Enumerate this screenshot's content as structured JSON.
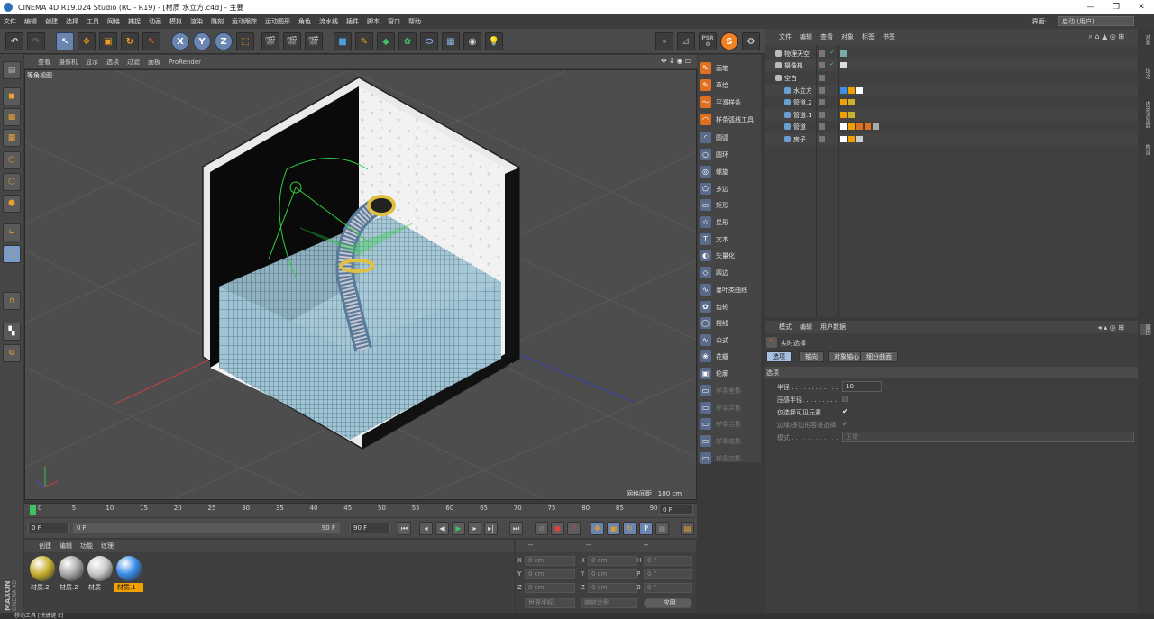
{
  "app": {
    "title": "CINEMA 4D R19.024 Studio (RC - R19) - [材质 水立方.c4d] - 主要"
  },
  "menu": [
    "文件",
    "编辑",
    "创建",
    "选择",
    "工具",
    "网格",
    "捕捉",
    "动画",
    "模拟",
    "渲染",
    "雕刻",
    "运动跟踪",
    "运动图形",
    "角色",
    "流水线",
    "插件",
    "脚本",
    "窗口",
    "帮助"
  ],
  "layout": {
    "label": "界面:",
    "value": "启动 (用户)"
  },
  "toolbar": {
    "coord_x": "X",
    "coord_y": "Y",
    "coord_z": "Z",
    "psr_label": "PSR",
    "psr_value": "0"
  },
  "viewport": {
    "menu": [
      "查看",
      "摄像机",
      "显示",
      "选项",
      "过滤",
      "面板",
      "ProRender"
    ],
    "label": "等角视图",
    "grid_info": "网格间距 : 100 cm"
  },
  "spline_palette": {
    "items": [
      "画笔",
      "草绘",
      "平滑样条",
      "样条弧线工具",
      "圆弧",
      "圆环",
      "螺旋",
      "多边",
      "矩形",
      "星形",
      "文本",
      "矢量化",
      "四边",
      "蔓叶类曲线",
      "齿轮",
      "摆线",
      "公式",
      "花瓣",
      "轮廓",
      "样条差集",
      "样条并集",
      "样条合集",
      "样条或集",
      "样条交集"
    ],
    "disabled_from": 19
  },
  "timeline": {
    "ticks": [
      "0",
      "5",
      "10",
      "15",
      "20",
      "25",
      "30",
      "35",
      "40",
      "45",
      "50",
      "55",
      "60",
      "65",
      "70",
      "75",
      "80",
      "85",
      "90"
    ],
    "current_frame": "0 F",
    "start": "0 F",
    "range_start": "0 F",
    "range_end": "90 F",
    "end": "90 F"
  },
  "materials": {
    "menu": [
      "创建",
      "编辑",
      "功能",
      "纹理"
    ],
    "items": [
      {
        "name": "材质.2",
        "color": "#c8b030"
      },
      {
        "name": "材质.2",
        "color": "#a8a8a8"
      },
      {
        "name": "材质",
        "color": "#c8c8c8"
      },
      {
        "name": "材质.1",
        "color": "#3a8ee8",
        "active": true
      }
    ]
  },
  "coordinates": {
    "headers": [
      "--",
      "--",
      "--"
    ],
    "rows": [
      {
        "axis": "X",
        "pos": "0 cm",
        "axis2": "X",
        "size": "0 cm",
        "rot_axis": "H",
        "rot": "0 °"
      },
      {
        "axis": "Y",
        "pos": "0 cm",
        "axis2": "Y",
        "size": "0 cm",
        "rot_axis": "P",
        "rot": "0 °"
      },
      {
        "axis": "Z",
        "pos": "0 cm",
        "axis2": "Z",
        "size": "0 cm",
        "rot_axis": "B",
        "rot": "0 °"
      }
    ],
    "world": "世界坐标",
    "scale": "缩放比例",
    "apply": "应用"
  },
  "object_manager": {
    "menu": [
      "文件",
      "编辑",
      "查看",
      "对象",
      "标签",
      "书签"
    ],
    "objects": [
      {
        "name": "物理天空",
        "indent": 0
      },
      {
        "name": "摄像机",
        "indent": 0
      },
      {
        "name": "空白",
        "indent": 0
      },
      {
        "name": "水立方",
        "indent": 1
      },
      {
        "name": "管道.2",
        "indent": 1
      },
      {
        "name": "管道.1",
        "indent": 1
      },
      {
        "name": "管道",
        "indent": 1
      },
      {
        "name": "房子",
        "indent": 1
      }
    ]
  },
  "attribute_manager": {
    "menu": [
      "模式",
      "编辑",
      "用户数据"
    ],
    "tool_name": "实时选择",
    "tabs": [
      "选项",
      "轴向",
      "对象轴心",
      "细分曲面"
    ],
    "section": "选项",
    "radius_label": "半径 . . . . . . . . . . . .",
    "radius_value": "10",
    "pressure_label": "压感半径. . . . . . . . .",
    "visible_label": "仅选择可见元素",
    "edge_label": "边缘/多边形容差选择",
    "mode_label": "模式 . . . . . . . . . . . .",
    "mode_value": "正常"
  },
  "right_tabs": [
    "对象",
    "场次",
    "内容浏览器",
    "构造"
  ],
  "right_tabs_attr": "属性",
  "status": "移动工具 [快捷键 E]",
  "brand": {
    "line1": "MAXON",
    "line2": "CINEMA 4D"
  }
}
